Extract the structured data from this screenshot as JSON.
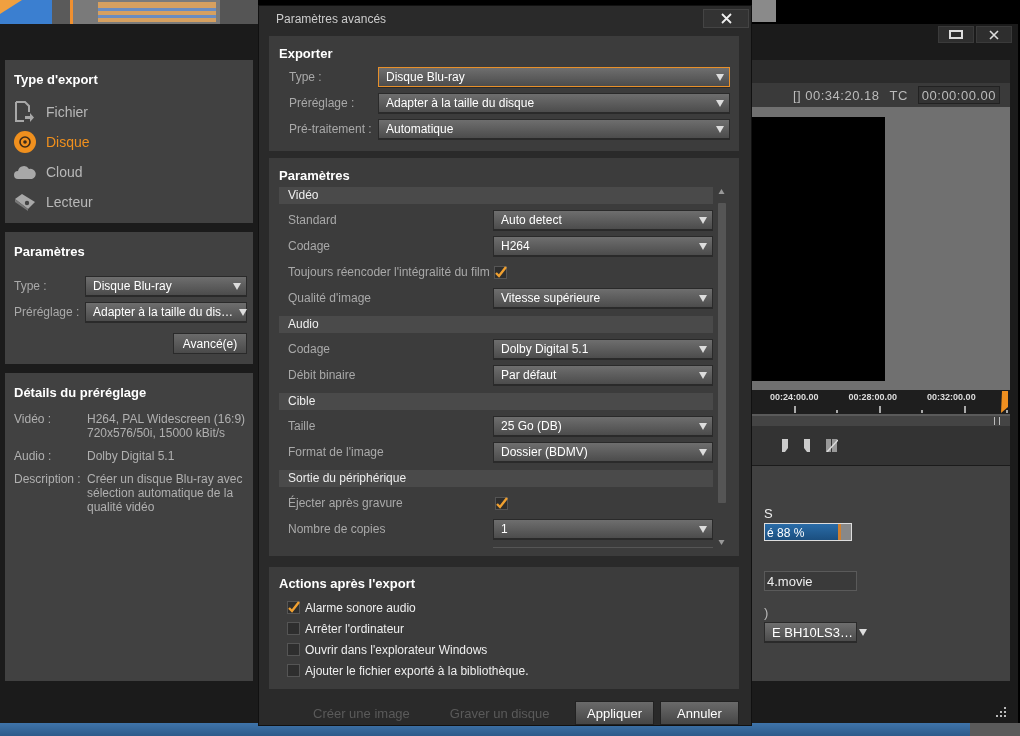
{
  "app": {
    "export_type": {
      "title": "Type d'export",
      "items": [
        {
          "label": "Fichier",
          "selected": false
        },
        {
          "label": "Disque",
          "selected": true
        },
        {
          "label": "Cloud",
          "selected": false
        },
        {
          "label": "Lecteur",
          "selected": false
        }
      ]
    },
    "settings": {
      "title": "Paramètres",
      "fields": [
        {
          "label": "Type :",
          "value": "Disque Blu-ray"
        },
        {
          "label": "Préréglage :",
          "value": "Adapter à la taille du dis…"
        }
      ],
      "advanced_button": "Avancé(e)"
    },
    "preset_details": {
      "title": "Détails du préréglage",
      "rows": [
        {
          "label": "Vidéo :",
          "value": "H264, PAL Widescreen (16:9) 720x576/50i, 15000 kBit/s"
        },
        {
          "label": "Audio :",
          "value": "Dolby Digital 5.1"
        },
        {
          "label": "Description :",
          "value": "Créer un disque Blu-ray avec sélection automatique de la qualité vidéo"
        }
      ]
    },
    "preview": {
      "duration": "[] 00:34:20.18",
      "tc_label": "TC",
      "timecode": "00:00:00.00",
      "ruler": [
        "00:24:00.00",
        "00:28:00.00",
        "00:32:00.00"
      ]
    },
    "output": {
      "heading_fragment": "S",
      "progress": {
        "text": "é 88 %",
        "level": 0.88
      },
      "file_fragment": "4.movie",
      "label_fragment": ")",
      "drive": "E  BH10LS3…"
    },
    "footer_buttons": [
      "Créer une image",
      "Graver un disque"
    ]
  },
  "dialog": {
    "title": "Paramètres avancés",
    "export": {
      "title": "Exporter",
      "fields": [
        {
          "label": "Type :",
          "value": "Disque Blu-ray",
          "focused": true
        },
        {
          "label": "Préréglage :",
          "value": "Adapter à la taille du disque",
          "focused": false
        },
        {
          "label": "Pré-traitement :",
          "value": "Automatique",
          "focused": false
        }
      ]
    },
    "parameters": {
      "title": "Paramètres",
      "groups": [
        {
          "title": "Vidéo",
          "rows": [
            {
              "kind": "dropdown",
              "label": "Standard",
              "value": "Auto detect"
            },
            {
              "kind": "dropdown",
              "label": "Codage",
              "value": "H264"
            },
            {
              "kind": "inline_checkbox",
              "label": "Toujours réencoder l'intégralité du film",
              "checked": true
            },
            {
              "kind": "dropdown",
              "label": "Qualité d'image",
              "value": "Vitesse supérieure"
            }
          ]
        },
        {
          "title": "Audio",
          "rows": [
            {
              "kind": "dropdown",
              "label": "Codage",
              "value": "Dolby Digital 5.1"
            },
            {
              "kind": "dropdown",
              "label": "Débit binaire",
              "value": "Par défaut"
            }
          ]
        },
        {
          "title": "Cible",
          "rows": [
            {
              "kind": "dropdown",
              "label": "Taille",
              "value": "25 Go (DB)"
            },
            {
              "kind": "dropdown",
              "label": "Format de l'image",
              "value": "Dossier (BDMV)"
            }
          ]
        },
        {
          "title": "Sortie du périphérique",
          "rows": [
            {
              "kind": "checkbox",
              "label": "Éjecter après gravure",
              "checked": true
            },
            {
              "kind": "dropdown",
              "label": "Nombre de copies",
              "value": "1"
            }
          ]
        }
      ]
    },
    "after_export": {
      "title": "Actions après l'export",
      "options": [
        {
          "label": "Alarme sonore audio",
          "checked": true
        },
        {
          "label": "Arrêter l'ordinateur",
          "checked": false
        },
        {
          "label": "Ouvrir dans l'explorateur Windows",
          "checked": false
        },
        {
          "label": "Ajouter le fichier exporté à la bibliothèque.",
          "checked": false
        }
      ]
    },
    "buttons": [
      "Appliquer",
      "Annuler"
    ]
  }
}
